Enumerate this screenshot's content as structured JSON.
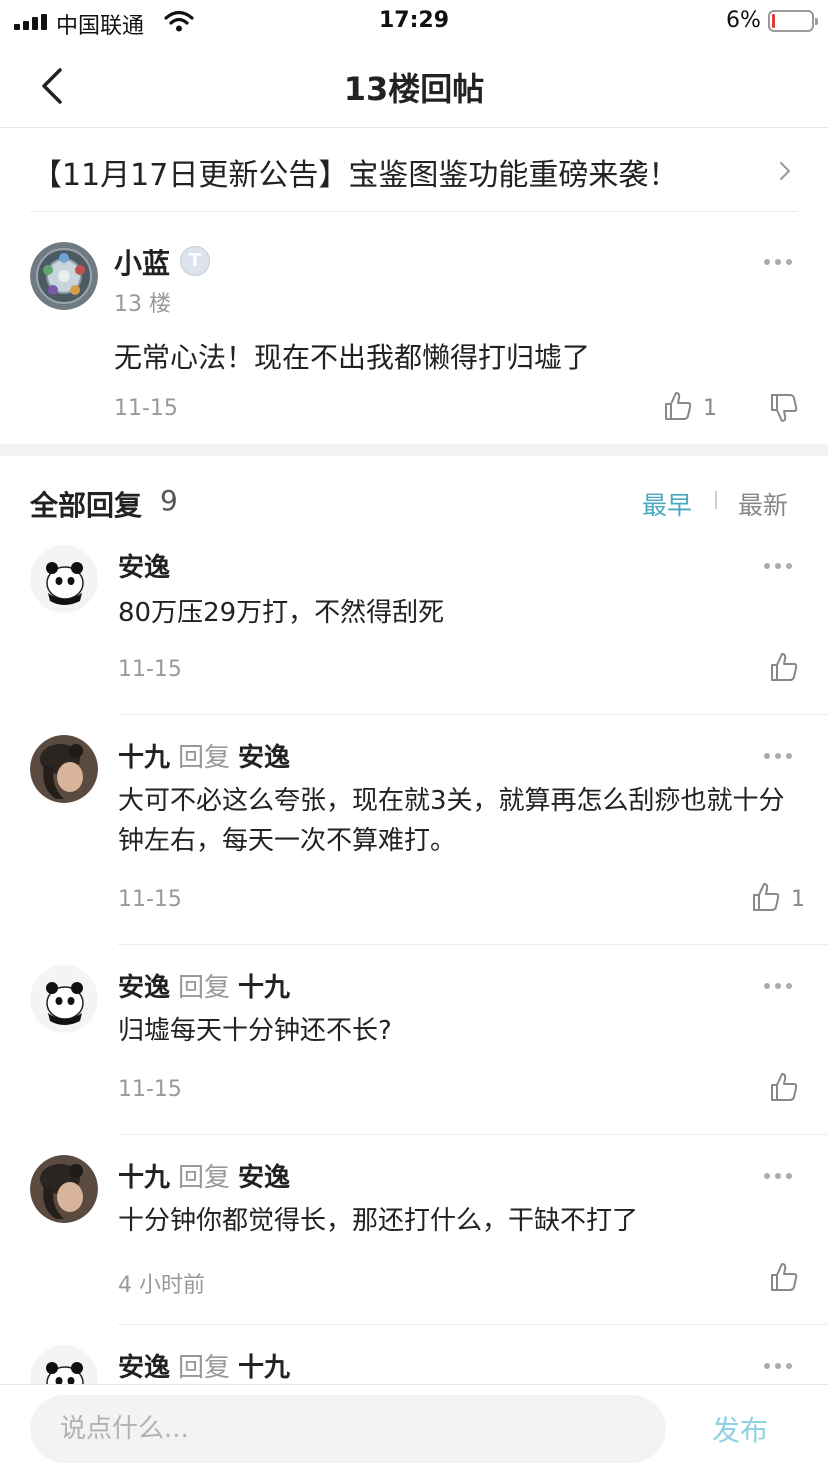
{
  "status_bar": {
    "carrier": "中国联通",
    "time": "17:29",
    "battery": "6%"
  },
  "nav": {
    "title": "13楼回帖",
    "back_icon": "chevron-left-icon"
  },
  "announcement": {
    "text": "【11月17日更新公告】宝鉴图鉴功能重磅来袭！"
  },
  "post": {
    "author": "小蓝",
    "badge": "T",
    "floor": "13 楼",
    "content": "无常心法！现在不出我都懒得打归墟了",
    "date": "11-15",
    "likes": "1"
  },
  "replies_header": {
    "title": "全部回复",
    "count": "9",
    "sort_earliest": "最早",
    "sort_latest": "最新",
    "active_sort": "最早"
  },
  "replies": [
    {
      "author": "安逸",
      "text": "80万压29万打，不然得刮死",
      "date": "11-15",
      "likes": ""
    },
    {
      "author": "十九",
      "verb": "回复",
      "target": "安逸",
      "text": "大可不必这么夸张，现在就3关，就算再怎么刮痧也就十分钟左右，每天一次不算难打。",
      "date": "11-15",
      "likes": "1"
    },
    {
      "author": "安逸",
      "verb": "回复",
      "target": "十九",
      "text": "归墟每天十分钟还不长?",
      "date": "11-15",
      "likes": ""
    },
    {
      "author": "十九",
      "verb": "回复",
      "target": "安逸",
      "text": "十分钟你都觉得长，那还打什么，干缺不打了",
      "date": "4 小时前",
      "likes": ""
    },
    {
      "author": "安逸",
      "verb": "回复",
      "target": "十九"
    }
  ],
  "input": {
    "placeholder": "说点什么...",
    "publish_label": "发布"
  },
  "colors": {
    "accent": "#4aa8c2",
    "publish": "#8fd0e2",
    "muted": "#999999"
  }
}
